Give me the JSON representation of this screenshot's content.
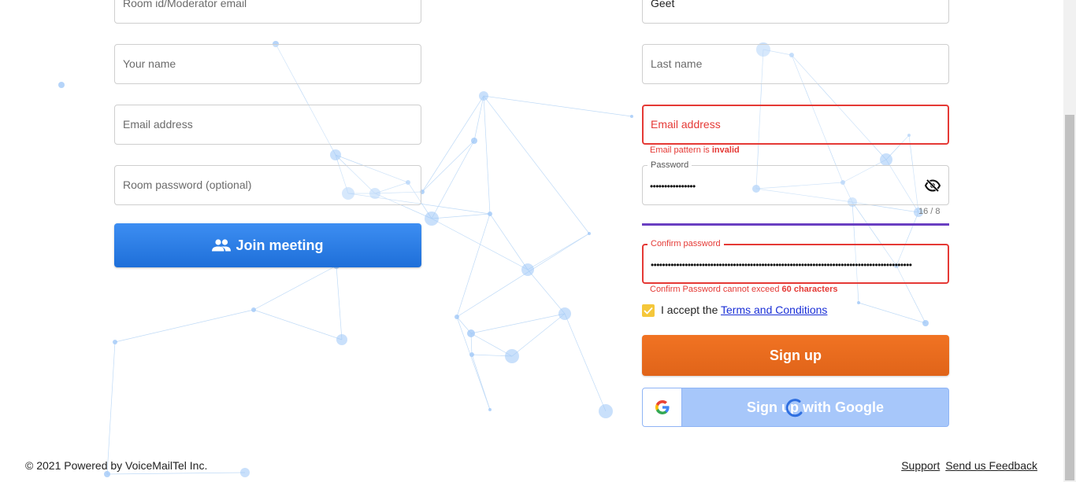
{
  "join_form": {
    "room_id_placeholder": "Room id/Moderator email",
    "your_name_placeholder": "Your name",
    "email_placeholder": "Email address",
    "room_password_placeholder": "Room password (optional)",
    "join_button_label": "Join meeting"
  },
  "signup_form": {
    "first_name_value": "Geet",
    "last_name_placeholder": "Last name",
    "email_placeholder": "Email address",
    "email_error_prefix": "Email pattern is ",
    "email_error_emphasis": "invalid",
    "password_label": "Password",
    "password_dots": "••••••••••••••••",
    "password_counter": "16 / 8",
    "confirm_password_label": "Confirm password",
    "confirm_password_dots": "••••••••••••••••••••••••••••••••••••••••••••••••••••••••••••••••••••••••••••••••••••••••••••",
    "confirm_error_prefix": "Confirm Password cannot exceed ",
    "confirm_error_emphasis": "60 characters",
    "terms_prefix": "I accept the ",
    "terms_link": "Terms and Conditions",
    "terms_checked": true,
    "signup_button_label": "Sign up",
    "google_button_label": "Sign up with Google"
  },
  "footer": {
    "copyright": "© 2021 Powered by VoiceMailTel Inc.",
    "support_link": "Support",
    "feedback_link": "Send us Feedback"
  },
  "colors": {
    "join_button": "#2a7de8",
    "signup_button": "#e86a1e",
    "google_button": "#a7c7fa",
    "error": "#e53935",
    "strength_bar": "#6a3fc2",
    "checkbox": "#f5c73a"
  },
  "icons": {
    "join": "people-icon",
    "password_toggle": "eye-off-icon",
    "google": "google-g-icon",
    "loading": "spinner-icon",
    "checkbox": "check-icon"
  }
}
